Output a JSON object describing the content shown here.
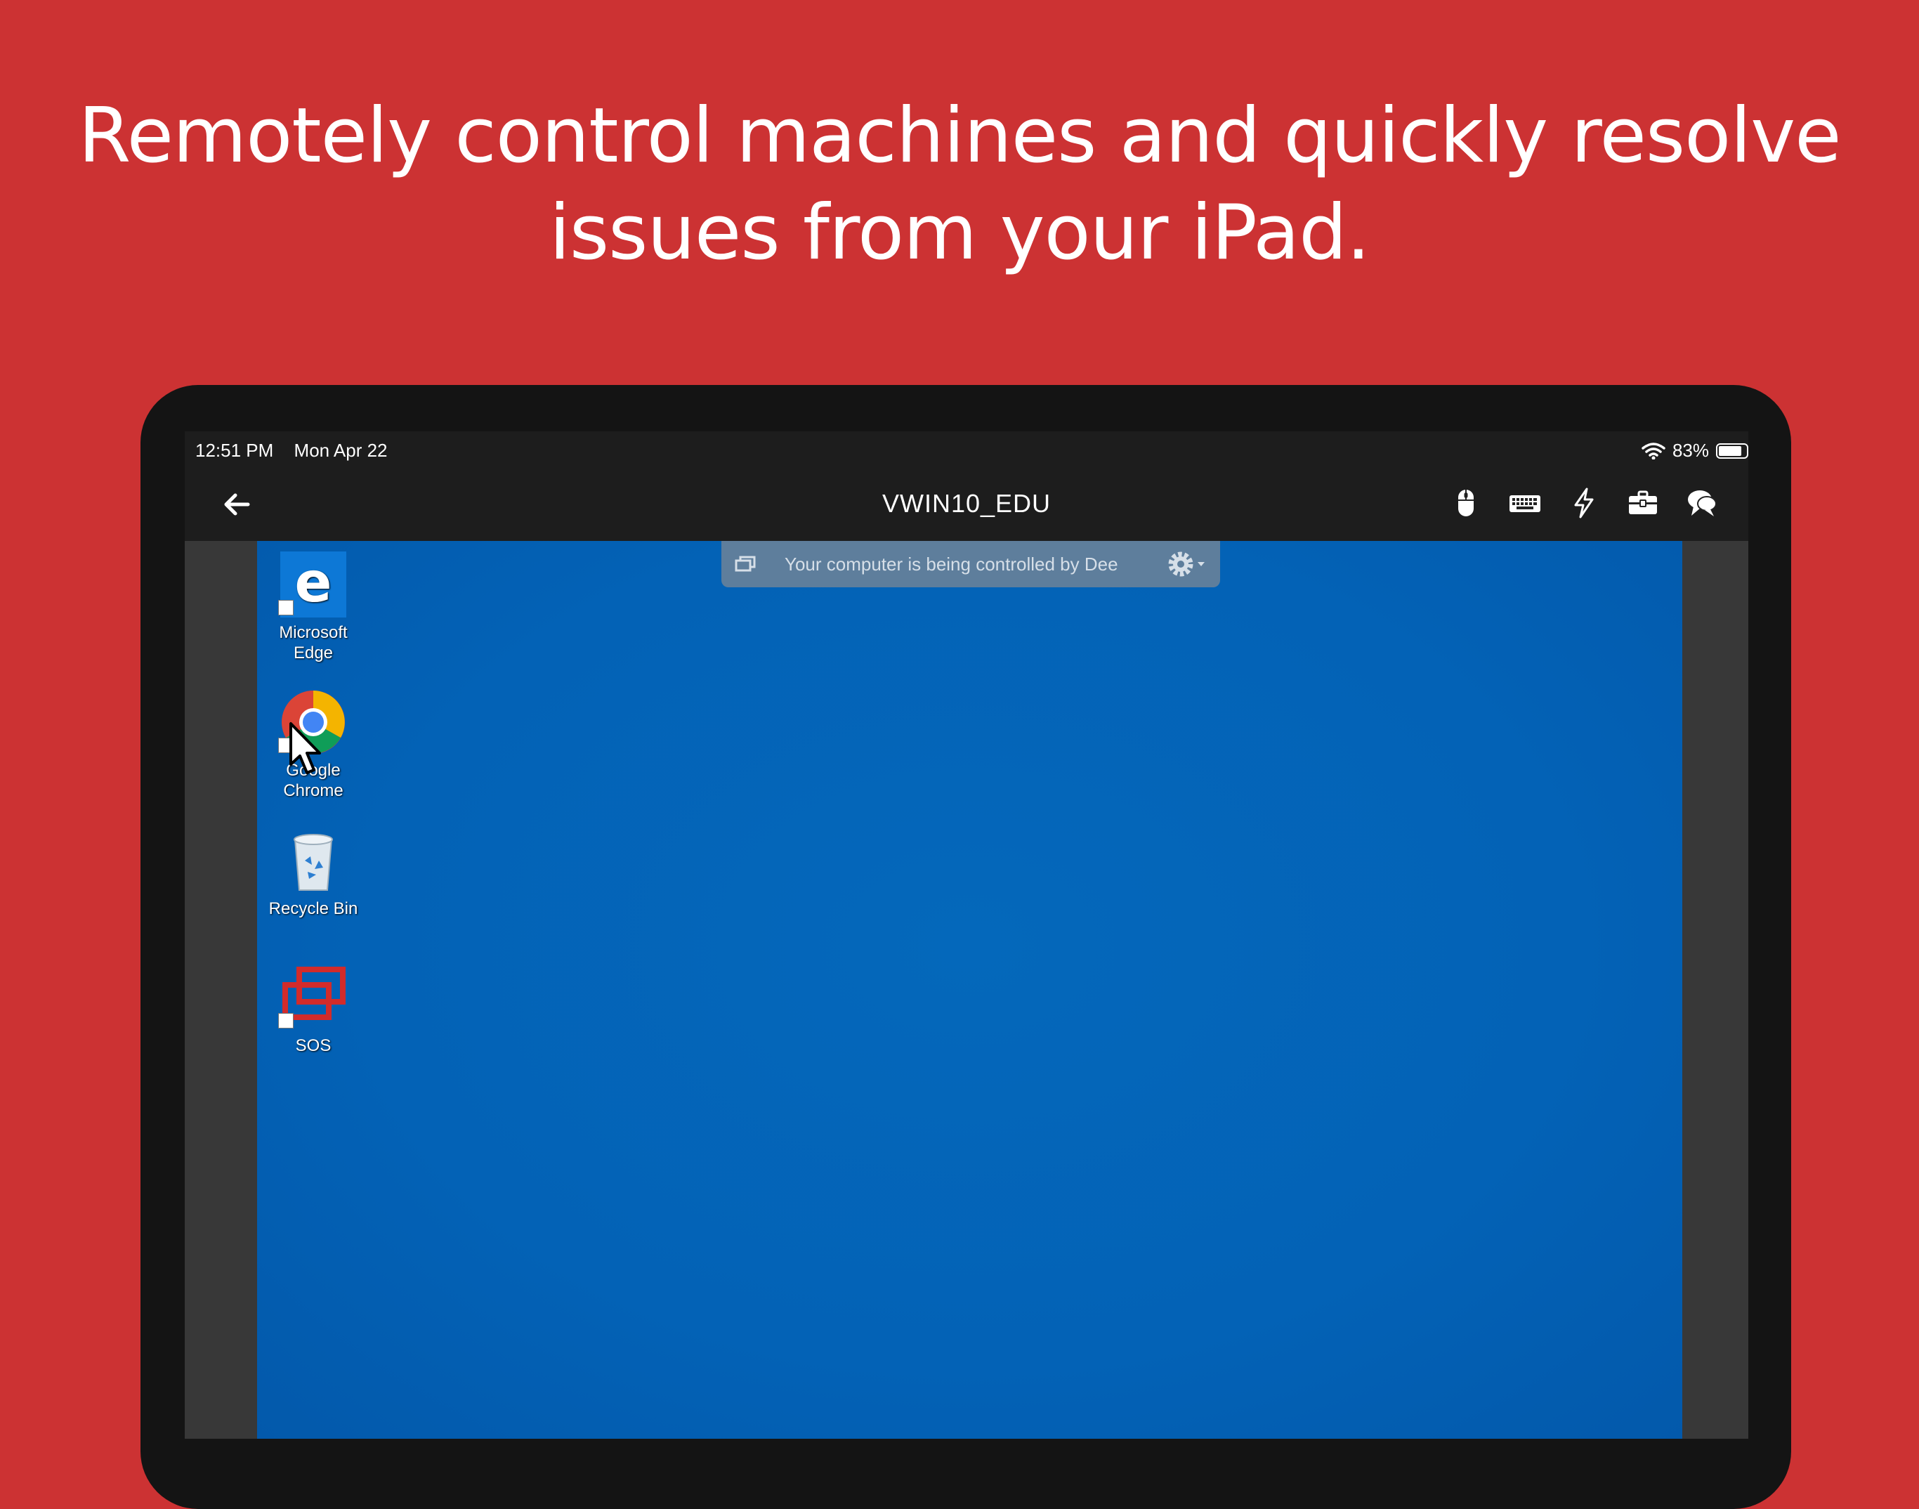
{
  "headline": {
    "line1": "Remotely control machines and quickly resolve",
    "line2": "issues from your iPad."
  },
  "status_bar": {
    "time": "12:51 PM",
    "date": "Mon Apr 22",
    "battery": "83%",
    "battery_level": 0.83
  },
  "nav": {
    "title": "VWIN10_EDU",
    "back_icon": "arrow-left-icon",
    "tools": [
      "mouse-icon",
      "keyboard-icon",
      "lightning-icon",
      "toolbox-icon",
      "chat-icon"
    ]
  },
  "remote_desktop": {
    "banner": "Your computer is being controlled by Dee",
    "icons": [
      {
        "label_line1": "Microsoft",
        "label_line2": "Edge"
      },
      {
        "label_line1": "Google",
        "label_line2": "Chrome"
      },
      {
        "label_line1": "Recycle Bin",
        "label_line2": ""
      },
      {
        "label_line1": "SOS",
        "label_line2": ""
      }
    ]
  },
  "colors": {
    "background": "#cc3233",
    "desktop": "#0362b6",
    "banner": "#5e7e9c",
    "device": "#141414"
  }
}
